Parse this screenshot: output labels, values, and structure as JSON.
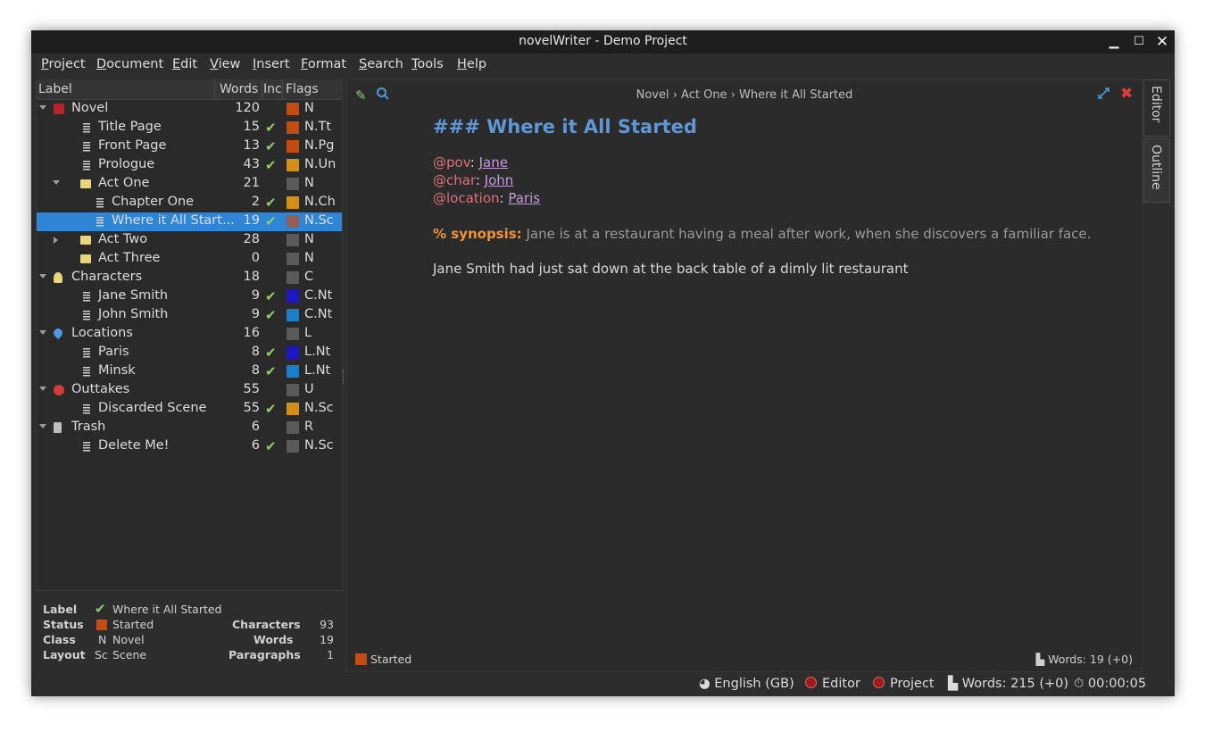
{
  "window": {
    "title": "novelWriter - Demo Project"
  },
  "menu": [
    "Project",
    "Document",
    "Edit",
    "View",
    "Insert",
    "Format",
    "Search",
    "Tools",
    "Help"
  ],
  "tree": {
    "headers": {
      "label": "Label",
      "words": "Words",
      "inc": "Inc",
      "flags": "Flags"
    },
    "rows": [
      {
        "label": "Novel",
        "words": "120",
        "inc": "",
        "flag": "N",
        "color": "#c34c10",
        "icon": "novel-root-icon",
        "depth": 0,
        "arrow": "down",
        "selected": false
      },
      {
        "label": "Title Page",
        "words": "15",
        "inc": "✔",
        "flag": "N.Tt",
        "color": "#c34c10",
        "icon": "document-icon",
        "depth": 1,
        "arrow": "",
        "selected": false
      },
      {
        "label": "Front Page",
        "words": "13",
        "inc": "✔",
        "flag": "N.Pg",
        "color": "#c34c10",
        "icon": "document-icon",
        "depth": 1,
        "arrow": "",
        "selected": false
      },
      {
        "label": "Prologue",
        "words": "43",
        "inc": "✔",
        "flag": "N.Un",
        "color": "#d39016",
        "icon": "document-icon",
        "depth": 1,
        "arrow": "",
        "selected": false
      },
      {
        "label": "Act One",
        "words": "21",
        "inc": "",
        "flag": "N",
        "color": "#5a5a5a",
        "icon": "folder-icon",
        "depth": 1,
        "arrow": "down",
        "selected": false
      },
      {
        "label": "Chapter One",
        "words": "2",
        "inc": "✔",
        "flag": "N.Ch",
        "color": "#d39016",
        "icon": "document-icon",
        "depth": 2,
        "arrow": "",
        "selected": false
      },
      {
        "label": "Where it All Start...",
        "words": "19",
        "inc": "✔",
        "flag": "N.Sc",
        "color": "#9a5a55",
        "icon": "document-icon",
        "depth": 2,
        "arrow": "",
        "selected": true
      },
      {
        "label": "Act Two",
        "words": "28",
        "inc": "",
        "flag": "N",
        "color": "#5a5a5a",
        "icon": "folder-icon",
        "depth": 1,
        "arrow": "right",
        "selected": false
      },
      {
        "label": "Act Three",
        "words": "0",
        "inc": "",
        "flag": "N",
        "color": "#5a5a5a",
        "icon": "folder-icon",
        "depth": 1,
        "arrow": "",
        "selected": false
      },
      {
        "label": "Characters",
        "words": "18",
        "inc": "",
        "flag": "C",
        "color": "#5a5a5a",
        "icon": "character-root-icon",
        "depth": 0,
        "arrow": "down",
        "selected": false
      },
      {
        "label": "Jane Smith",
        "words": "9",
        "inc": "✔",
        "flag": "C.Nt",
        "color": "#1d16c4",
        "icon": "document-icon",
        "depth": 1,
        "arrow": "",
        "selected": false
      },
      {
        "label": "John Smith",
        "words": "9",
        "inc": "✔",
        "flag": "C.Nt",
        "color": "#1a7fc4",
        "icon": "document-icon",
        "depth": 1,
        "arrow": "",
        "selected": false
      },
      {
        "label": "Locations",
        "words": "16",
        "inc": "",
        "flag": "L",
        "color": "#5a5a5a",
        "icon": "location-root-icon",
        "depth": 0,
        "arrow": "down",
        "selected": false
      },
      {
        "label": "Paris",
        "words": "8",
        "inc": "✔",
        "flag": "L.Nt",
        "color": "#1d16c4",
        "icon": "document-icon",
        "depth": 1,
        "arrow": "",
        "selected": false
      },
      {
        "label": "Minsk",
        "words": "8",
        "inc": "✔",
        "flag": "L.Nt",
        "color": "#1a7fc4",
        "icon": "document-icon",
        "depth": 1,
        "arrow": "",
        "selected": false
      },
      {
        "label": "Outtakes",
        "words": "55",
        "inc": "",
        "flag": "U",
        "color": "#5a5a5a",
        "icon": "outtakes-root-icon",
        "depth": 0,
        "arrow": "down",
        "selected": false
      },
      {
        "label": "Discarded Scene",
        "words": "55",
        "inc": "✔",
        "flag": "N.Sc",
        "color": "#d39016",
        "icon": "document-icon",
        "depth": 1,
        "arrow": "",
        "selected": false
      },
      {
        "label": "Trash",
        "words": "6",
        "inc": "",
        "flag": "R",
        "color": "#5a5a5a",
        "icon": "trash-icon",
        "depth": 0,
        "arrow": "down",
        "selected": false
      },
      {
        "label": "Delete Me!",
        "words": "6",
        "inc": "✔",
        "flag": "N.Sc",
        "color": "#5a5a5a",
        "icon": "document-icon",
        "depth": 1,
        "arrow": "",
        "selected": false
      }
    ]
  },
  "details": {
    "label_key": "Label",
    "label_val": "Where it All Started",
    "status_key": "Status",
    "status_val": "Started",
    "class_key": "Class",
    "class_abbr": "N",
    "class_val": "Novel",
    "layout_key": "Layout",
    "layout_abbr": "Sc",
    "layout_val": "Scene",
    "chars_key": "Characters",
    "chars_val": "93",
    "words_key": "Words",
    "words_val": "19",
    "paras_key": "Paragraphs",
    "paras_val": "1"
  },
  "editor": {
    "crumbs": "Novel  ›  Act One  ›  Where it All Started",
    "heading": "### Where it All Started",
    "pov_kw": "@pov",
    "pov_ref": "Jane",
    "char_kw": "@char",
    "char_ref": "John",
    "loc_kw": "@location",
    "loc_ref": "Paris",
    "synopsis_kw": "% synopsis:",
    "synopsis_text": " Jane is at a restaurant having a meal after work, when she discovers a familiar face.",
    "body": "Jane Smith had just sat down at the back table of a dimly lit restaurant",
    "status": "Started",
    "words": "Words: 19 (+0)"
  },
  "sidetabs": {
    "editor": "Editor",
    "outline": "Outline"
  },
  "statusbar": {
    "language": "English (GB)",
    "editor": "Editor",
    "project": "Project",
    "words": "Words: 215 (+0)",
    "time": "00:00:05"
  }
}
